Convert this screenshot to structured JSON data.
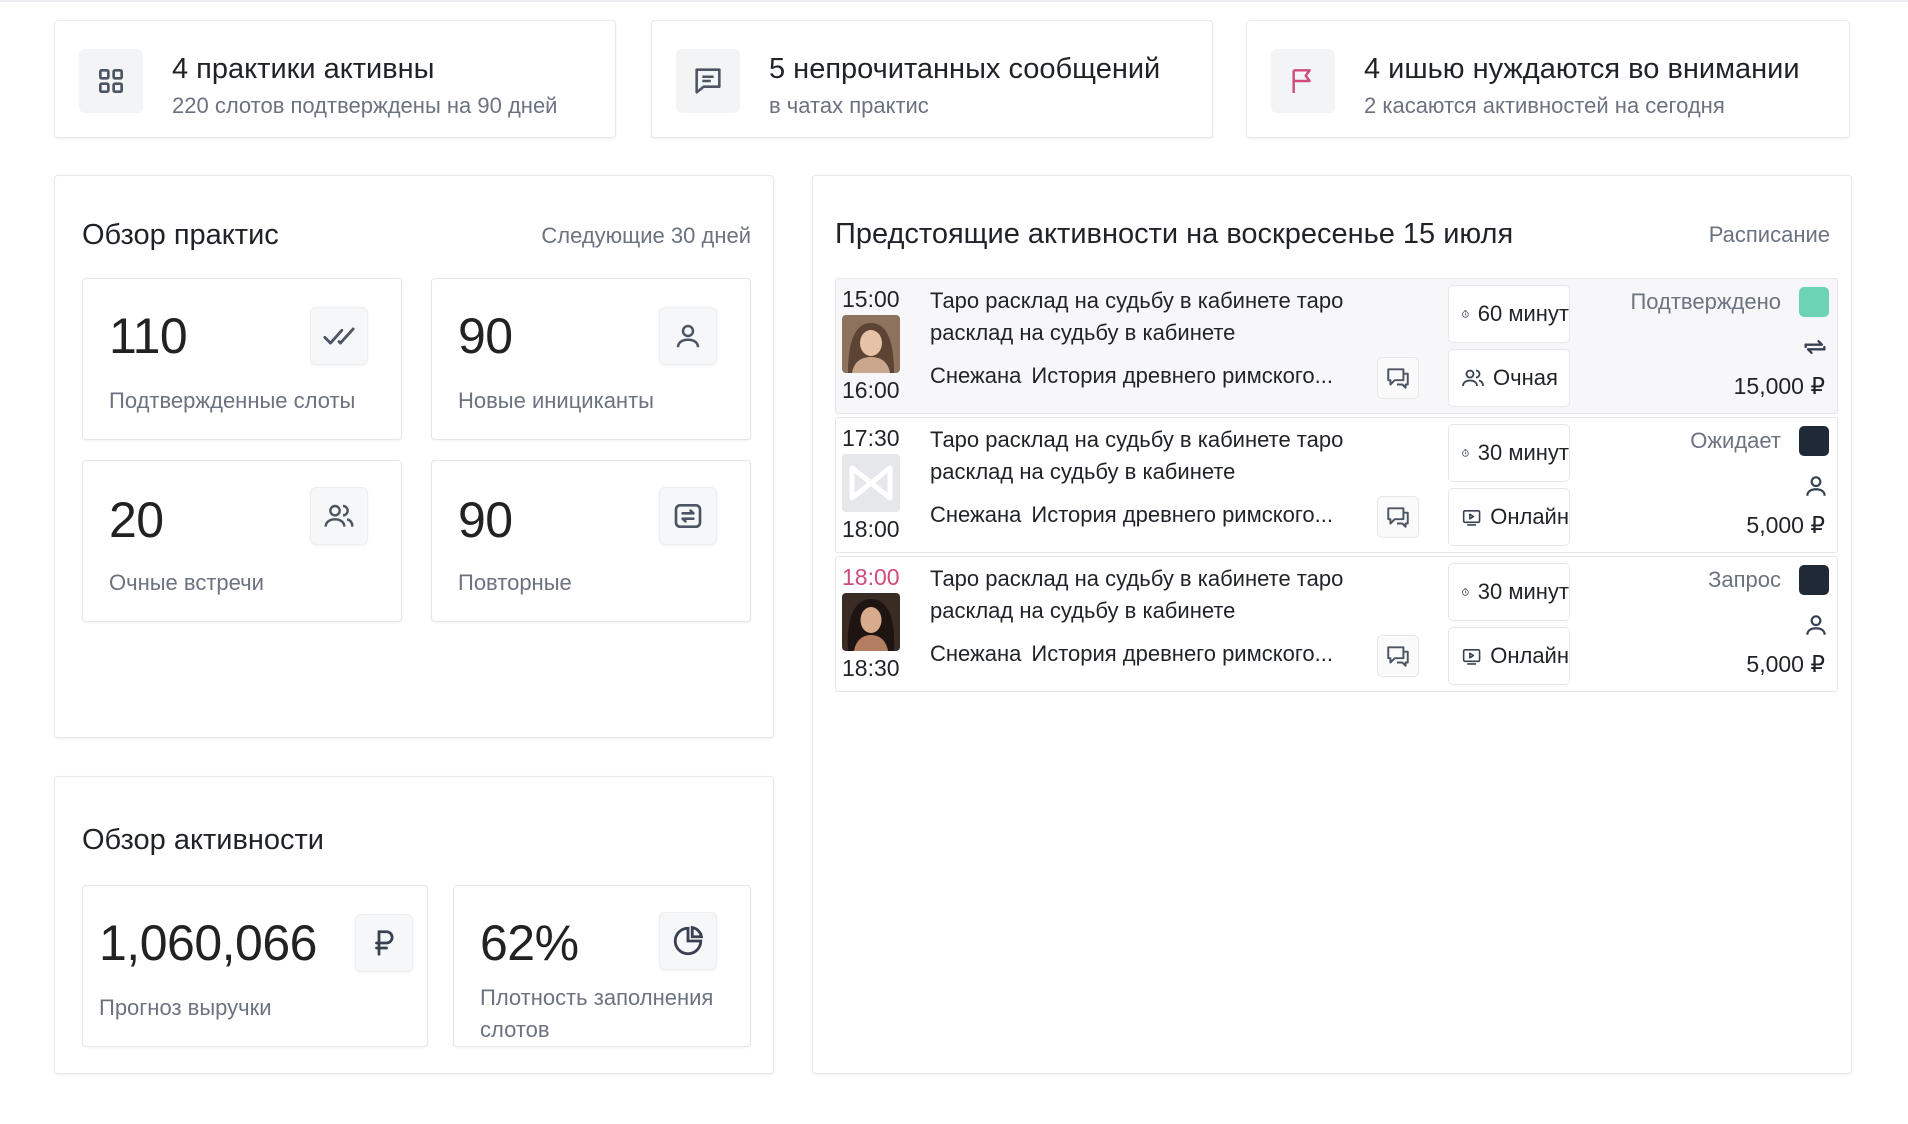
{
  "stats": [
    {
      "icon": "grid-icon",
      "title": "4 практики активны",
      "subtitle": "220 слотов подтверждены на 90 дней"
    },
    {
      "icon": "message-icon",
      "title": "5 непрочитанных сообщений",
      "subtitle": "в чатах практис"
    },
    {
      "icon": "flag-icon",
      "title": "4 ишью нуждаются во внимании",
      "subtitle": "2 касаются активностей на сегодня",
      "icon_color": "#d04a7a"
    }
  ],
  "practice_overview": {
    "title": "Обзор практис",
    "period": "Следующие 30 дней",
    "metrics": [
      {
        "value": "110",
        "label": "Подтвержденные слоты",
        "icon": "double-check-icon"
      },
      {
        "value": "90",
        "label": "Новые инициканты",
        "icon": "user-icon"
      },
      {
        "value": "20",
        "label": "Очные встречи",
        "icon": "users-icon"
      },
      {
        "value": "90",
        "label": "Повторные",
        "icon": "repeat-icon"
      }
    ]
  },
  "activity_overview": {
    "title": "Обзор активности",
    "metrics": [
      {
        "value": "1,060,066",
        "label": "Прогноз выручки",
        "icon": "ruble-icon"
      },
      {
        "value": "62%",
        "label": "Плотность заполнения слотов",
        "icon": "pie-chart-icon"
      }
    ]
  },
  "upcoming": {
    "title": "Предстоящие активности на воскресенье 15 июля",
    "link": "Расписание",
    "rows": [
      {
        "start": "15:00",
        "end": "16:00",
        "title": "Таро расклад на судьбу в кабинете таро расклад на судьбу в кабинете",
        "host": "Снежана",
        "topic": "История древнего римского...",
        "duration": "60 минут",
        "format": "Очная",
        "format_icon": "users-icon",
        "status": "Подтверждено",
        "status_color": "#6dd3b5",
        "type_icon": "repeat-icon",
        "price": "15,000 ₽"
      },
      {
        "start": "17:30",
        "end": "18:00",
        "title": "Таро расклад на судьбу в кабинете таро расклад на судьбу в кабинете",
        "host": "Снежана",
        "topic": "История древнего римского...",
        "duration": "30 минут",
        "format": "Онлайн",
        "format_icon": "video-icon",
        "status": "Ожидает",
        "status_color": "#1f2937",
        "type_icon": "user-icon",
        "price": "5,000 ₽"
      },
      {
        "start": "18:00",
        "end": "18:30",
        "title": "Таро расклад на судьбу в кабинете таро расклад на судьбу в кабинете",
        "host": "Снежана",
        "topic": "История древнего римского...",
        "duration": "30 минут",
        "format": "Онлайн",
        "format_icon": "video-icon",
        "status": "Запрос",
        "status_color": "#1f2937",
        "type_icon": "user-icon",
        "price": "5,000 ₽",
        "start_color": "#d04a7a"
      }
    ]
  }
}
